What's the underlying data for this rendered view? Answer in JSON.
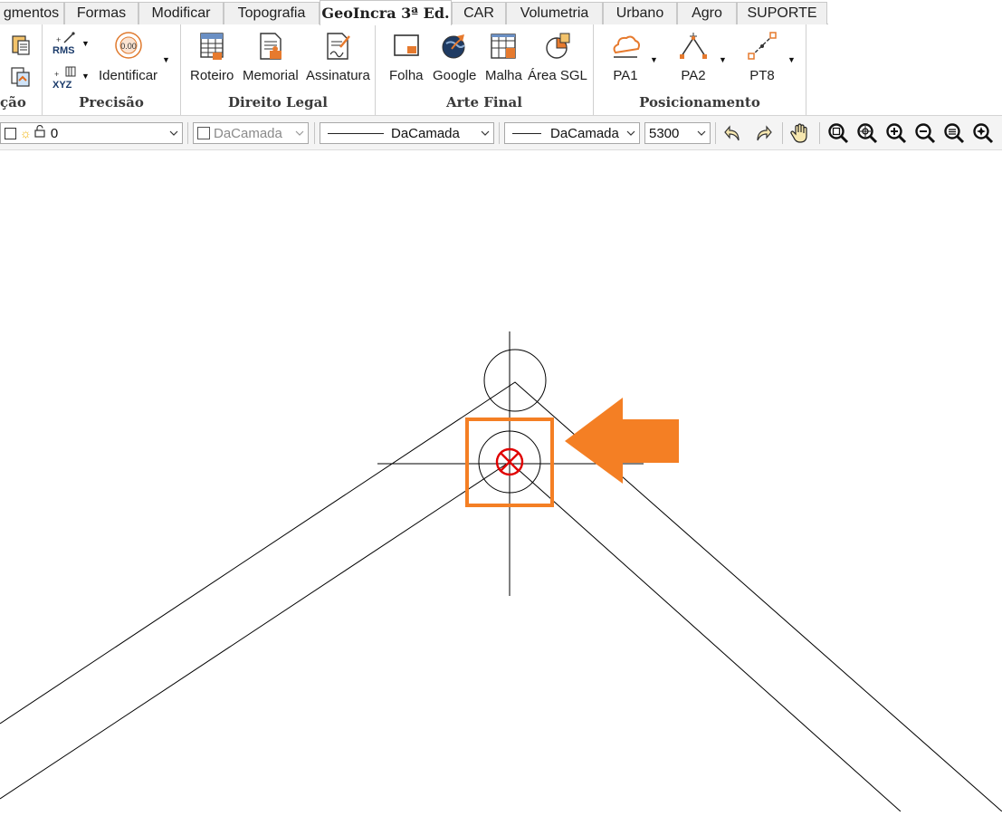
{
  "tabs": [
    {
      "label": "gmentos"
    },
    {
      "label": "Formas"
    },
    {
      "label": "Modificar"
    },
    {
      "label": "Topografia"
    },
    {
      "label": "GeoIncra 3ª Ed.",
      "active": true
    },
    {
      "label": "CAR"
    },
    {
      "label": "Volumetria"
    },
    {
      "label": "Urbano"
    },
    {
      "label": "Agro"
    },
    {
      "label": "SUPORTE"
    }
  ],
  "ribbon": {
    "groups": {
      "partial_label": "ção",
      "precisao": {
        "label": "Precisão",
        "rms_label": "RMS",
        "xyz_label": "XYZ",
        "identificar_label": "Identificar",
        "identificar_value": "0.00"
      },
      "direito_legal": {
        "label": "Direito Legal",
        "roteiro": "Roteiro",
        "memorial": "Memorial",
        "assinatura": "Assinatura"
      },
      "arte_final": {
        "label": "Arte Final",
        "folha": "Folha",
        "google": "Google",
        "malha": "Malha",
        "area_sgl": "Área SGL"
      },
      "posicionamento": {
        "label": "Posicionamento",
        "pa1": "PA1",
        "pa2": "PA2",
        "pt8": "PT8"
      }
    }
  },
  "toolbar": {
    "layer_value": "0",
    "color_value": "DaCamada",
    "linetype_value": "DaCamada",
    "lineweight_value": "DaCamada",
    "scale_value": "5300"
  },
  "colors": {
    "accent_orange": "#f47f24",
    "snap_red": "#e00000",
    "line_black": "#000000"
  }
}
